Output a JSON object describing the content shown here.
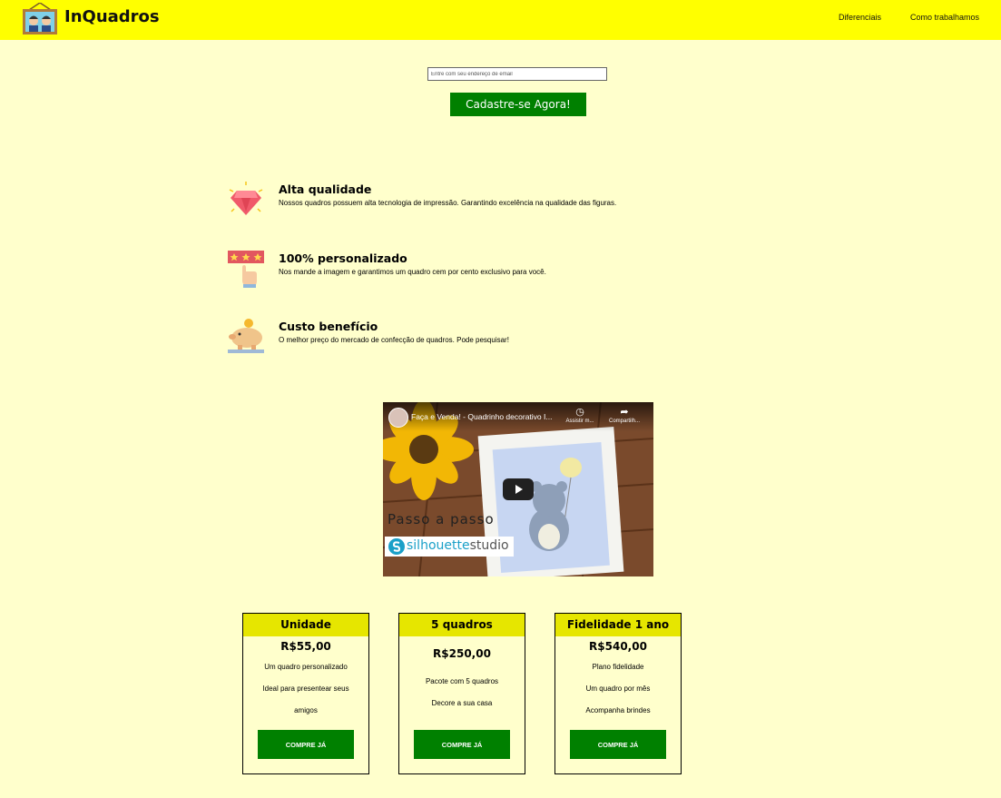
{
  "header": {
    "brand": "InQuadros",
    "nav": [
      "Diferenciais",
      "Como trabalhamos"
    ]
  },
  "signup": {
    "email_placeholder": "Entre com seu endereço de email",
    "button_label": "Cadastre-se Agora!"
  },
  "features": [
    {
      "icon": "diamond-icon",
      "title": "Alta qualidade",
      "description": "Nossos quadros possuem alta tecnologia de impressão. Garantindo excelência na qualidade das figuras."
    },
    {
      "icon": "rating-hand-icon",
      "title": "100% personalizado",
      "description": "Nos mande a imagem e garantimos um quadro cem por cento exclusivo para você."
    },
    {
      "icon": "piggy-bank-icon",
      "title": "Custo benefício",
      "description": "O melhor preço do mercado de confecção de quadros. Pode pesquisar!"
    }
  ],
  "video": {
    "title": "Faça e Venda! - Quadrinho decorativo I...",
    "watch_later": "Assistir m...",
    "share": "Compartilh...",
    "overlay_text": "Passo a passo",
    "badge_text_1": "silhouette",
    "badge_text_2": "studio"
  },
  "plans": [
    {
      "name": "Unidade",
      "price": "R$55,00",
      "features": [
        "Um quadro personalizado",
        "Ideal para presentear seus",
        "amigos"
      ],
      "cta": "COMPRE JÁ"
    },
    {
      "name": "5 quadros",
      "price": "R$250,00",
      "features": [
        "Pacote com 5 quadros",
        "Decore a sua casa"
      ],
      "cta": "COMPRE JÁ"
    },
    {
      "name": "Fidelidade 1 ano",
      "price": "R$540,00",
      "features": [
        "Plano fidelidade",
        "Um quadro por mês",
        "Acompanha brindes"
      ],
      "cta": "COMPRE JÁ"
    }
  ],
  "colors": {
    "header_bg": "#ffff00",
    "page_bg": "#ffffcc",
    "button_green": "#008000",
    "card_header": "#e6e600"
  }
}
